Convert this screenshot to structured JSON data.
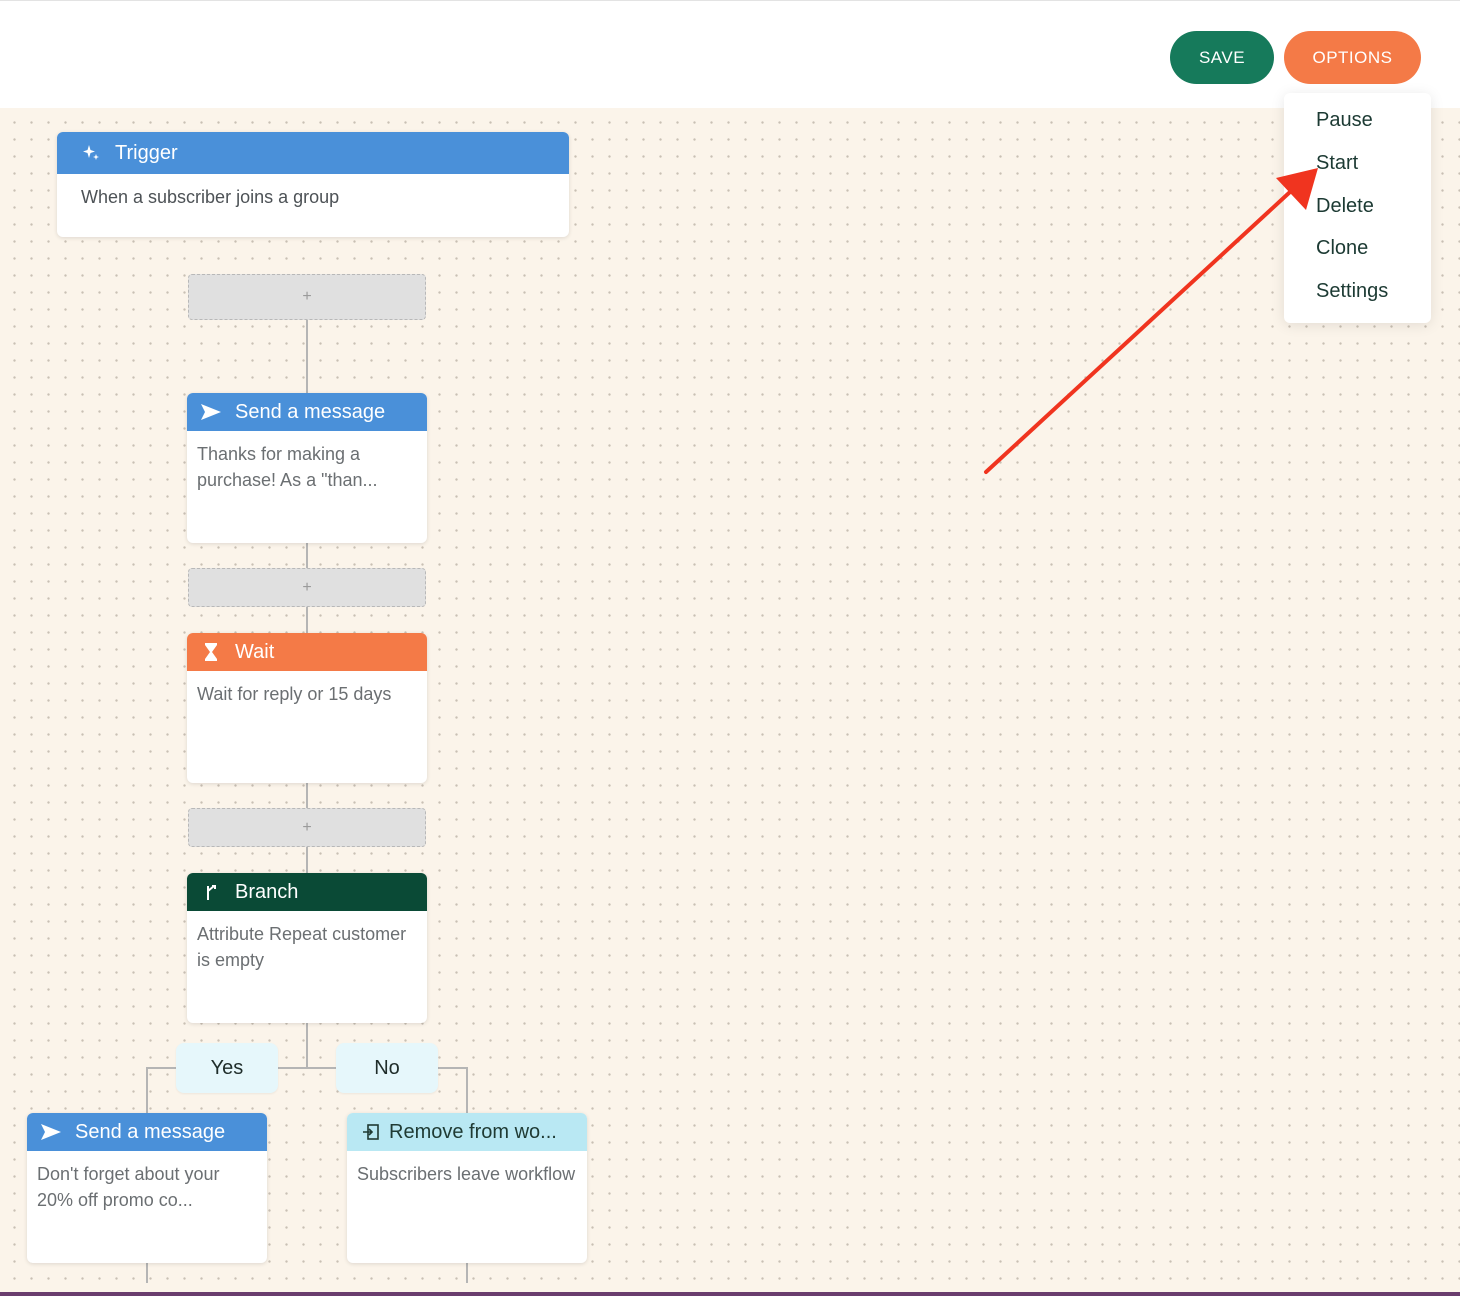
{
  "toolbar": {
    "save_label": "SAVE",
    "options_label": "OPTIONS"
  },
  "options_menu": {
    "items": [
      {
        "label": "Pause"
      },
      {
        "label": "Start"
      },
      {
        "label": "Delete"
      },
      {
        "label": "Clone"
      },
      {
        "label": "Settings"
      }
    ]
  },
  "workflow": {
    "adder_symbol": "+",
    "trigger": {
      "title": "Trigger",
      "body": "When a subscriber joins a group",
      "icon": "sparkle-icon",
      "color": "#4a90d9"
    },
    "send_message_1": {
      "title": "Send a message",
      "body": "Thanks for making a purchase! As a \"than...",
      "icon": "send-icon",
      "color": "#4a90d9"
    },
    "wait": {
      "title": "Wait",
      "body": "Wait for reply or 15 days",
      "icon": "hourglass-icon",
      "color": "#f47a47"
    },
    "branch": {
      "title": "Branch",
      "body": "Attribute Repeat customer is empty",
      "icon": "branch-icon",
      "color": "#0a4a36"
    },
    "branch_yes_label": "Yes",
    "branch_no_label": "No",
    "send_message_2": {
      "title": "Send a message",
      "body": "Don't forget about your 20% off promo co...",
      "icon": "send-icon",
      "color": "#4a90d9"
    },
    "remove": {
      "title": "Remove from wo...",
      "body": "Subscribers leave workflow",
      "icon": "exit-icon",
      "color": "#b9e8f3"
    }
  },
  "colors": {
    "save": "#167a5b",
    "options": "#f47a47",
    "canvas": "#fbf4ea",
    "annotation_arrow": "#f0341f"
  }
}
